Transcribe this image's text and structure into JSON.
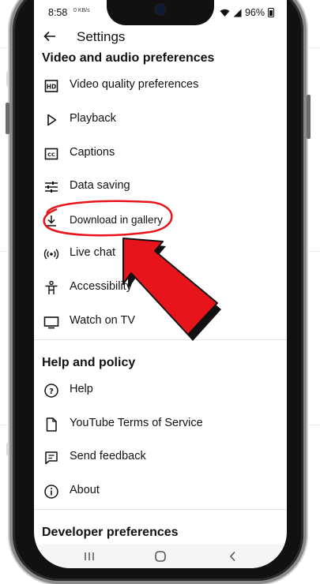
{
  "status_bar": {
    "time": "8:58",
    "small_indicator": "0 KB/s",
    "battery": "96%"
  },
  "app_bar": {
    "title": "Settings",
    "back_icon": "arrow-left-icon"
  },
  "sections": [
    {
      "header": "Video and audio preferences",
      "items": [
        {
          "label": "Video quality preferences",
          "icon": "hd-icon"
        },
        {
          "label": "Playback",
          "icon": "play-icon"
        },
        {
          "label": "Captions",
          "icon": "cc-icon"
        },
        {
          "label": "Data saving",
          "icon": "sliders-icon"
        },
        {
          "label": "Download in gallery",
          "icon": "download-icon"
        },
        {
          "label": "Live chat",
          "icon": "broadcast-icon"
        },
        {
          "label": "Accessibility",
          "icon": "accessibility-icon"
        },
        {
          "label": "Watch on TV",
          "icon": "tv-icon"
        }
      ]
    },
    {
      "header": "Help and policy",
      "items": [
        {
          "label": "Help",
          "icon": "help-icon"
        },
        {
          "label": "YouTube Terms of Service",
          "icon": "document-icon"
        },
        {
          "label": "Send feedback",
          "icon": "feedback-icon"
        },
        {
          "label": "About",
          "icon": "info-icon"
        }
      ]
    },
    {
      "header": "Developer preferences",
      "items": []
    }
  ],
  "annotation": {
    "highlight_color": "#e8141b",
    "arrow_color": "#e8141b",
    "highlighted_item": "Download in gallery"
  },
  "nav_bar": {
    "buttons": [
      "recents-icon",
      "home-icon",
      "back-icon"
    ]
  }
}
